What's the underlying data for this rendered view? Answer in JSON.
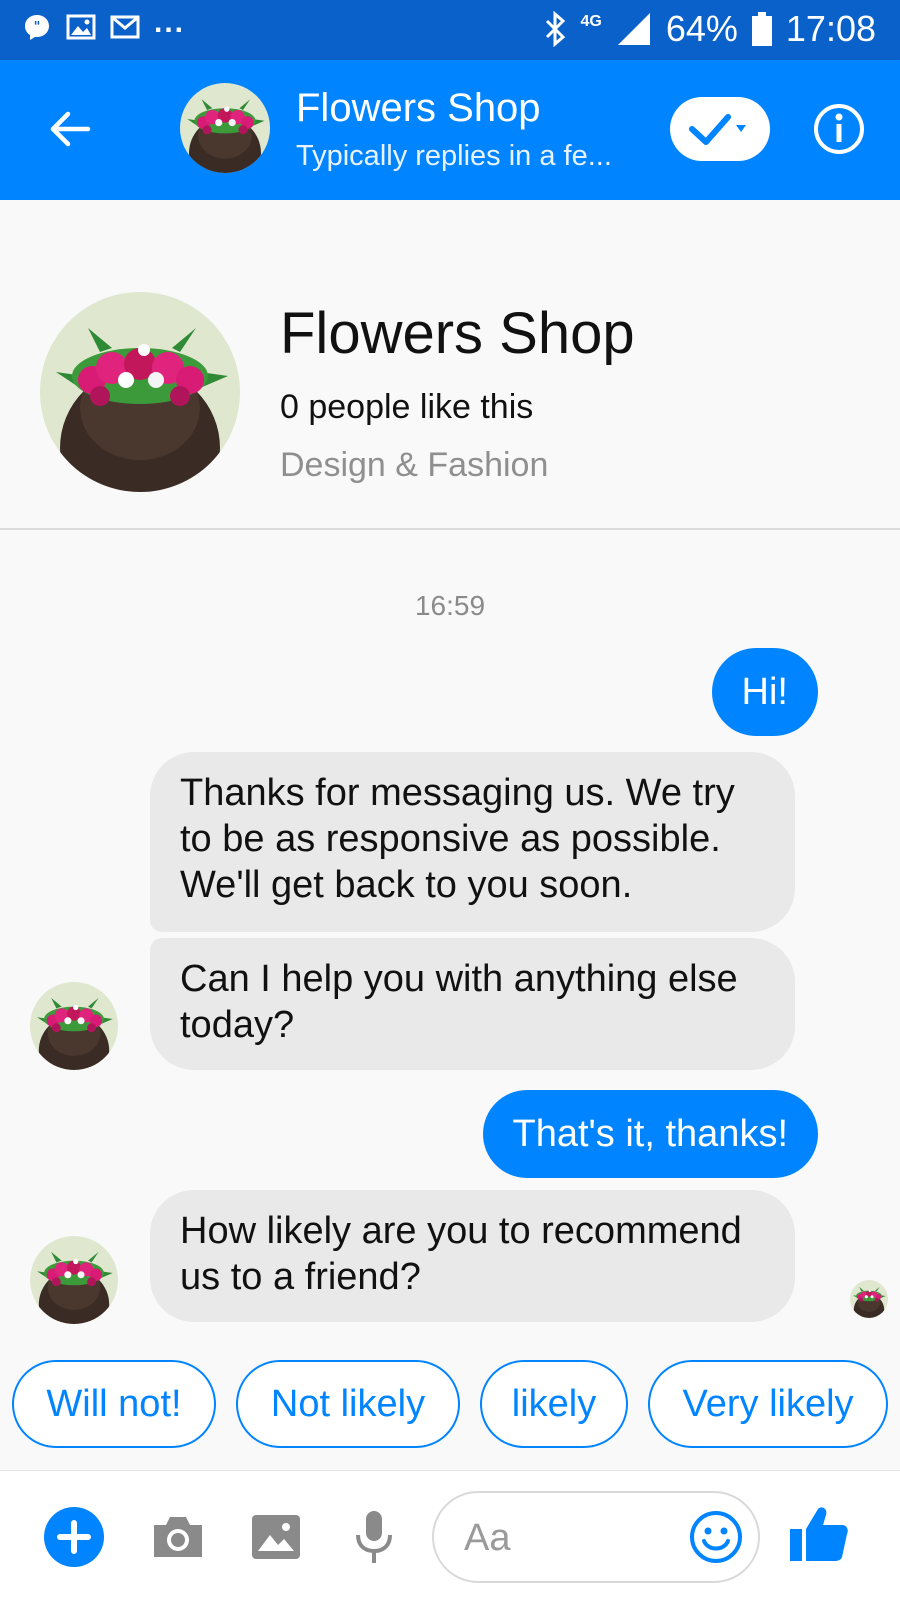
{
  "status_bar": {
    "battery": "64%",
    "time": "17:08",
    "network": "4G",
    "overflow": "..."
  },
  "header": {
    "title": "Flowers Shop",
    "subtitle": "Typically replies in a fe..."
  },
  "profile": {
    "name": "Flowers Shop",
    "likes": "0 people like this",
    "category": "Design & Fashion"
  },
  "conversation": {
    "timestamp": "16:59",
    "messages": [
      {
        "from": "me",
        "text": "Hi!"
      },
      {
        "from": "shop",
        "text": "Thanks for messaging us. We try to be as responsive as possible. We'll get back to you soon."
      },
      {
        "from": "shop",
        "text": "Can I help you with anything else today?"
      },
      {
        "from": "me",
        "text": "That's it, thanks!"
      },
      {
        "from": "shop",
        "text": "How likely are you to recommend us to a friend?"
      }
    ]
  },
  "quick_replies": [
    "Will not!",
    "Not likely",
    "likely",
    "Very likely"
  ],
  "composer": {
    "placeholder": "Aa"
  },
  "colors": {
    "status_bar": "#0a61c9",
    "accent": "#0084ff",
    "incoming_bubble": "#e9e9e9"
  },
  "icons": [
    "chat-notification-icon",
    "image-notification-icon",
    "gmail-notification-icon",
    "bluetooth-icon",
    "signal-icon",
    "battery-icon",
    "back-arrow-icon",
    "checkmark-dropdown-icon",
    "info-icon",
    "plus-icon",
    "camera-icon",
    "gallery-icon",
    "microphone-icon",
    "emoji-icon",
    "thumbs-up-icon"
  ]
}
